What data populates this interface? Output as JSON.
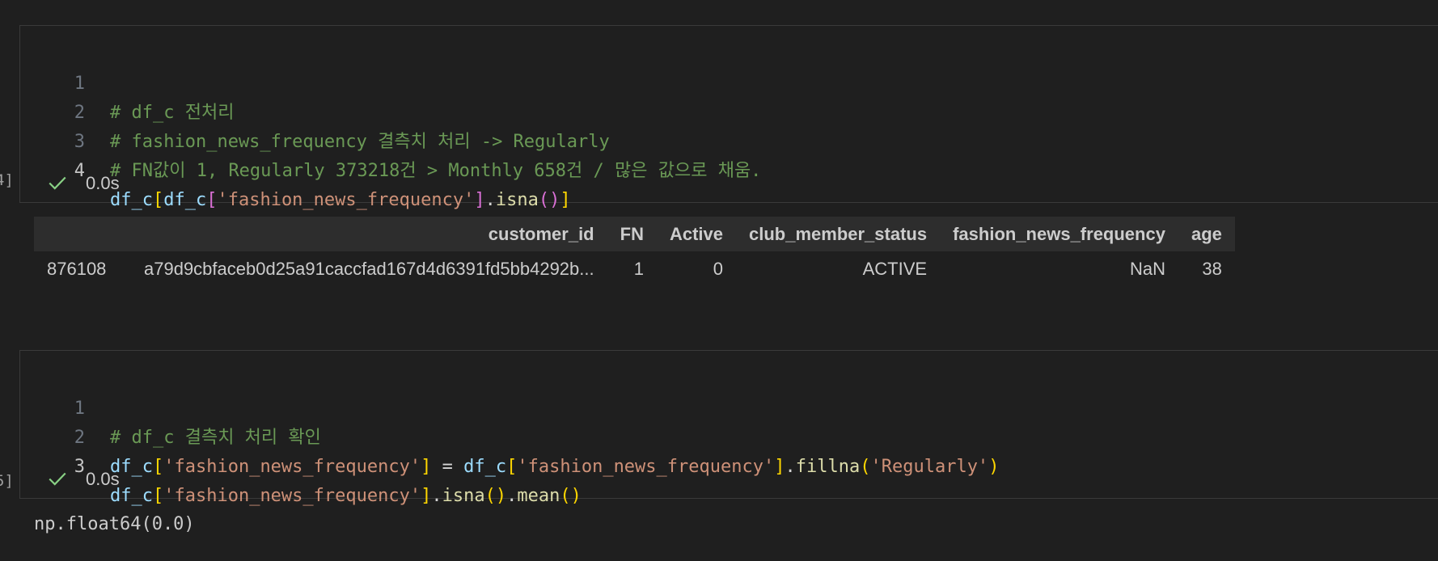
{
  "cell1": {
    "exec_count": "4]",
    "lines": [
      {
        "num": "1",
        "text": "# df_c 전처리"
      },
      {
        "num": "2",
        "text": "# fashion_news_frequency 결측치 처리 -> Regularly"
      },
      {
        "num": "3",
        "text": "# FN값이 1, Regularly 373218건 > Monthly 658건 / 많은 값으로 채움."
      },
      {
        "num": "4",
        "tokens": [
          "df_c",
          "[",
          "df_c",
          "[",
          "'fashion_news_frequency'",
          "]",
          ".",
          "isna",
          "(",
          ")",
          "]"
        ]
      }
    ],
    "status_time": "0.0s"
  },
  "output1": {
    "table": {
      "headers": [
        "",
        "customer_id",
        "FN",
        "Active",
        "club_member_status",
        "fashion_news_frequency",
        "age"
      ],
      "rows": [
        [
          "876108",
          "a79d9cbfaceb0d25a91caccfad167d4d6391fd5bb4292b...",
          "1",
          "0",
          "ACTIVE",
          "NaN",
          "38"
        ]
      ]
    }
  },
  "cell2": {
    "exec_count": "5]",
    "lines": [
      {
        "num": "1",
        "text": "# df_c 결측치 처리 확인"
      },
      {
        "num": "2",
        "tokens": [
          "df_c",
          "[",
          "'fashion_news_frequency'",
          "]",
          " = ",
          "df_c",
          "[",
          "'fashion_news_frequency'",
          "]",
          ".",
          "fillna",
          "(",
          "'Regularly'",
          ")"
        ]
      },
      {
        "num": "3",
        "tokens": [
          "df_c",
          "[",
          "'fashion_news_frequency'",
          "]",
          ".",
          "isna",
          "()",
          ".",
          "mean",
          "()"
        ]
      }
    ],
    "status_time": "0.0s"
  },
  "output2": {
    "text": "np.float64(0.0)"
  },
  "colors": {
    "background": "#1f1f1f",
    "comment": "#6a9955",
    "variable": "#9cdcfe",
    "string": "#ce9178",
    "function": "#dcdcaa",
    "bracket_gold": "#ffd700",
    "bracket_purple": "#da70d6",
    "success_check": "#89d185"
  },
  "icons": {
    "status": "check-icon"
  }
}
